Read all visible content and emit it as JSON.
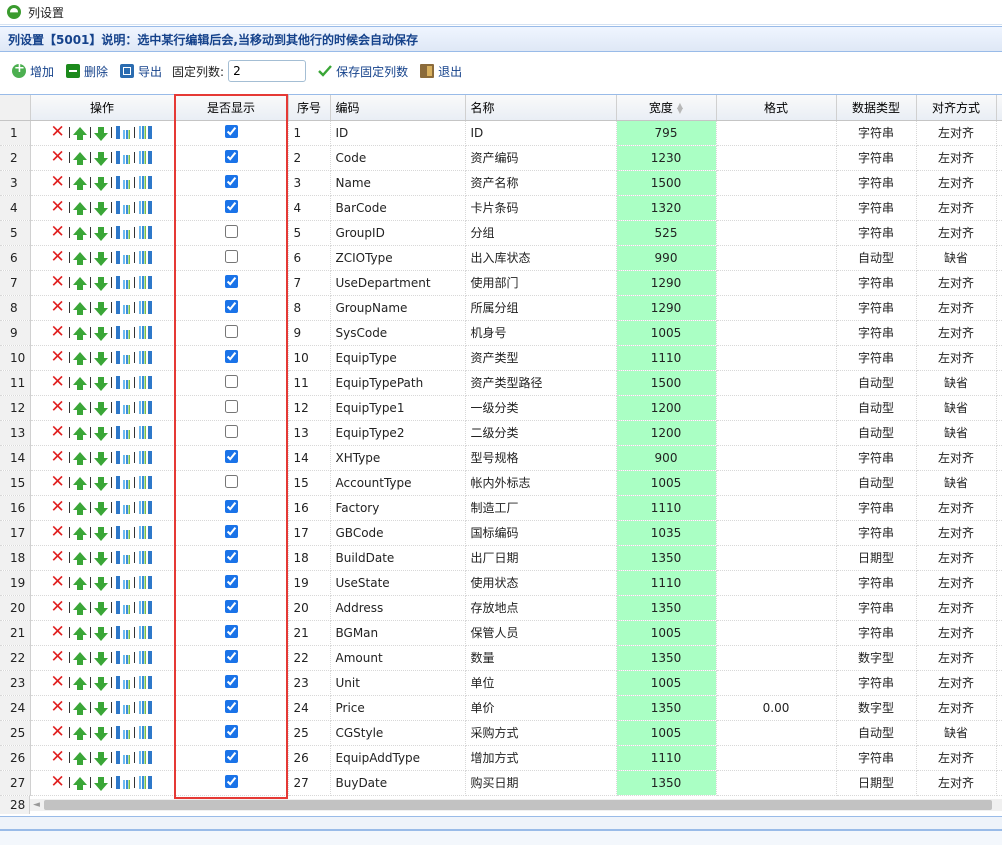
{
  "window": {
    "title": "列设置"
  },
  "panel": {
    "header": "列设置【5001】说明：选中某行编辑后会,当移动到其他行的时候会自动保存"
  },
  "toolbar": {
    "add_label": "增加",
    "delete_label": "删除",
    "export_label": "导出",
    "fixed_cols_label": "固定列数:",
    "fixed_cols_value": "2",
    "save_fixed_label": "保存固定列数",
    "exit_label": "退出"
  },
  "columns": {
    "ops": "操作",
    "visible": "是否显示",
    "seq": "序号",
    "code": "编码",
    "name": "名称",
    "width": "宽度",
    "format": "格式",
    "datatype": "数据类型",
    "align": "对齐方式"
  },
  "highlight_color": "#e53935",
  "width_cell_color": "#aaffc4",
  "rows": [
    {
      "rn": "1",
      "visible": true,
      "seq": "1",
      "code": "ID",
      "name": "ID",
      "width": "795",
      "format": "",
      "type": "字符串",
      "align": "左对齐"
    },
    {
      "rn": "2",
      "visible": true,
      "seq": "2",
      "code": "Code",
      "name": "资产编码",
      "width": "1230",
      "format": "",
      "type": "字符串",
      "align": "左对齐"
    },
    {
      "rn": "3",
      "visible": true,
      "seq": "3",
      "code": "Name",
      "name": "资产名称",
      "width": "1500",
      "format": "",
      "type": "字符串",
      "align": "左对齐"
    },
    {
      "rn": "4",
      "visible": true,
      "seq": "4",
      "code": "BarCode",
      "name": "卡片条码",
      "width": "1320",
      "format": "",
      "type": "字符串",
      "align": "左对齐"
    },
    {
      "rn": "5",
      "visible": false,
      "seq": "5",
      "code": "GroupID",
      "name": "分组",
      "width": "525",
      "format": "",
      "type": "字符串",
      "align": "左对齐"
    },
    {
      "rn": "6",
      "visible": false,
      "seq": "6",
      "code": "ZCIOType",
      "name": "出入库状态",
      "width": "990",
      "format": "",
      "type": "自动型",
      "align": "缺省"
    },
    {
      "rn": "7",
      "visible": true,
      "seq": "7",
      "code": "UseDepartment",
      "name": "使用部门",
      "width": "1290",
      "format": "",
      "type": "字符串",
      "align": "左对齐"
    },
    {
      "rn": "8",
      "visible": true,
      "seq": "8",
      "code": "GroupName",
      "name": "所属分组",
      "width": "1290",
      "format": "",
      "type": "字符串",
      "align": "左对齐"
    },
    {
      "rn": "9",
      "visible": false,
      "seq": "9",
      "code": "SysCode",
      "name": "机身号",
      "width": "1005",
      "format": "",
      "type": "字符串",
      "align": "左对齐"
    },
    {
      "rn": "10",
      "visible": true,
      "seq": "10",
      "code": "EquipType",
      "name": "资产类型",
      "width": "1110",
      "format": "",
      "type": "字符串",
      "align": "左对齐"
    },
    {
      "rn": "11",
      "visible": false,
      "seq": "11",
      "code": "EquipTypePath",
      "name": "资产类型路径",
      "width": "1500",
      "format": "",
      "type": "自动型",
      "align": "缺省"
    },
    {
      "rn": "12",
      "visible": false,
      "seq": "12",
      "code": "EquipType1",
      "name": "一级分类",
      "width": "1200",
      "format": "",
      "type": "自动型",
      "align": "缺省"
    },
    {
      "rn": "13",
      "visible": false,
      "seq": "13",
      "code": "EquipType2",
      "name": "二级分类",
      "width": "1200",
      "format": "",
      "type": "自动型",
      "align": "缺省"
    },
    {
      "rn": "14",
      "visible": true,
      "seq": "14",
      "code": "XHType",
      "name": "型号规格",
      "width": "900",
      "format": "",
      "type": "字符串",
      "align": "左对齐"
    },
    {
      "rn": "15",
      "visible": false,
      "seq": "15",
      "code": "AccountType",
      "name": "帐内外标志",
      "width": "1005",
      "format": "",
      "type": "自动型",
      "align": "缺省"
    },
    {
      "rn": "16",
      "visible": true,
      "seq": "16",
      "code": "Factory",
      "name": "制造工厂",
      "width": "1110",
      "format": "",
      "type": "字符串",
      "align": "左对齐"
    },
    {
      "rn": "17",
      "visible": true,
      "seq": "17",
      "code": "GBCode",
      "name": "国标编码",
      "width": "1035",
      "format": "",
      "type": "字符串",
      "align": "左对齐"
    },
    {
      "rn": "18",
      "visible": true,
      "seq": "18",
      "code": "BuildDate",
      "name": "出厂日期",
      "width": "1350",
      "format": "",
      "type": "日期型",
      "align": "左对齐"
    },
    {
      "rn": "19",
      "visible": true,
      "seq": "19",
      "code": "UseState",
      "name": "使用状态",
      "width": "1110",
      "format": "",
      "type": "字符串",
      "align": "左对齐"
    },
    {
      "rn": "20",
      "visible": true,
      "seq": "20",
      "code": "Address",
      "name": "存放地点",
      "width": "1350",
      "format": "",
      "type": "字符串",
      "align": "左对齐"
    },
    {
      "rn": "21",
      "visible": true,
      "seq": "21",
      "code": "BGMan",
      "name": "保管人员",
      "width": "1005",
      "format": "",
      "type": "字符串",
      "align": "左对齐"
    },
    {
      "rn": "22",
      "visible": true,
      "seq": "22",
      "code": "Amount",
      "name": "数量",
      "width": "1350",
      "format": "",
      "type": "数字型",
      "align": "左对齐"
    },
    {
      "rn": "23",
      "visible": true,
      "seq": "23",
      "code": "Unit",
      "name": "单位",
      "width": "1005",
      "format": "",
      "type": "字符串",
      "align": "左对齐"
    },
    {
      "rn": "24",
      "visible": true,
      "seq": "24",
      "code": "Price",
      "name": "单价",
      "width": "1350",
      "format": "0.00",
      "type": "数字型",
      "align": "左对齐"
    },
    {
      "rn": "25",
      "visible": true,
      "seq": "25",
      "code": "CGStyle",
      "name": "采购方式",
      "width": "1005",
      "format": "",
      "type": "自动型",
      "align": "缺省"
    },
    {
      "rn": "26",
      "visible": true,
      "seq": "26",
      "code": "EquipAddType",
      "name": "增加方式",
      "width": "1110",
      "format": "",
      "type": "字符串",
      "align": "左对齐"
    },
    {
      "rn": "27",
      "visible": true,
      "seq": "27",
      "code": "BuyDate",
      "name": "购买日期",
      "width": "1350",
      "format": "",
      "type": "日期型",
      "align": "左对齐"
    }
  ],
  "partial_row_number": "28"
}
